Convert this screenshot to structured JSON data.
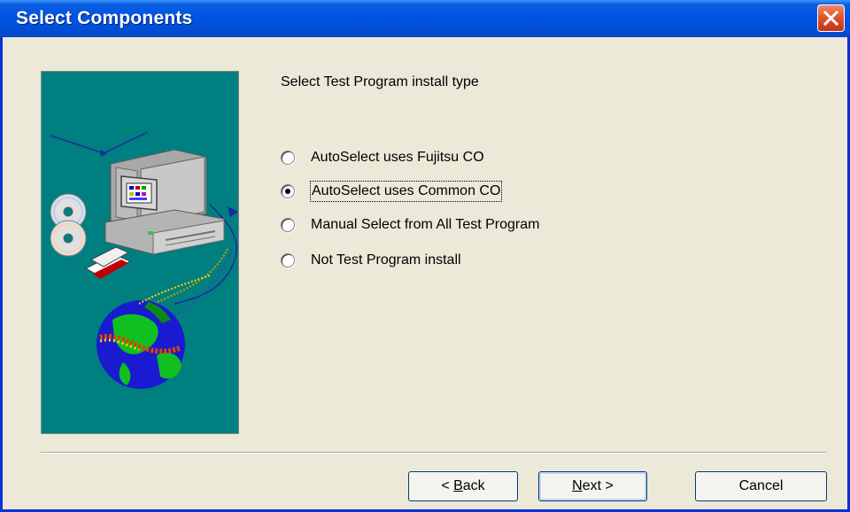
{
  "window": {
    "title": "Select Components",
    "close_icon": "close-icon"
  },
  "main": {
    "prompt": "Select Test Program install type",
    "options": [
      {
        "label": "AutoSelect uses Fujitsu CO",
        "selected": false
      },
      {
        "label": "AutoSelect uses Common CO",
        "selected": true
      },
      {
        "label": "Manual Select from All Test Program",
        "selected": false
      },
      {
        "label": "Not Test Program install",
        "selected": false
      }
    ]
  },
  "buttons": {
    "back": {
      "prefix": "< ",
      "mnemonic": "B",
      "rest": "ack"
    },
    "next": {
      "mnemonic": "N",
      "rest": "ext >"
    },
    "cancel": "Cancel"
  },
  "colors": {
    "titlebar": "#0054e3",
    "dialog_bg": "#ece9d8",
    "art_bg": "#007f80",
    "close_button": "#e0552e"
  }
}
